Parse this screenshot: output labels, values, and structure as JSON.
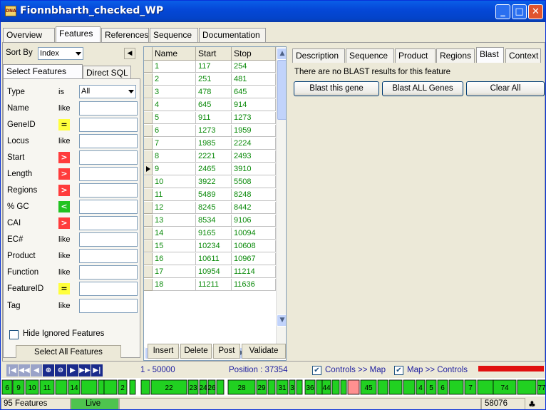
{
  "window": {
    "title": "Fionnbharth_checked_WP",
    "icon_text": "DNA"
  },
  "main_tabs": [
    {
      "label": "Overview",
      "active": false
    },
    {
      "label": "Features",
      "active": true
    },
    {
      "label": "References",
      "active": false
    },
    {
      "label": "Sequence",
      "active": false
    },
    {
      "label": "Documentation",
      "active": false
    }
  ],
  "left": {
    "sort_label": "Sort By",
    "sort_value": "Index",
    "tabs": [
      {
        "label": "Select Features",
        "active": true
      },
      {
        "label": "Direct SQL",
        "active": false
      }
    ],
    "filters": [
      {
        "name": "Type",
        "op": "is",
        "op_style": "text",
        "value": "All"
      },
      {
        "name": "Name",
        "op": "like",
        "op_style": "text",
        "value": ""
      },
      {
        "name": "GeneID",
        "op": "=",
        "op_style": "yellow",
        "value": ""
      },
      {
        "name": "Locus",
        "op": "like",
        "op_style": "text",
        "value": ""
      },
      {
        "name": "Start",
        "op": ">",
        "op_style": "red",
        "value": ""
      },
      {
        "name": "Length",
        "op": ">",
        "op_style": "red",
        "value": ""
      },
      {
        "name": "Regions",
        "op": ">",
        "op_style": "red",
        "value": ""
      },
      {
        "name": "% GC",
        "op": "<",
        "op_style": "green",
        "value": ""
      },
      {
        "name": "CAI",
        "op": ">",
        "op_style": "red",
        "value": ""
      },
      {
        "name": "EC#",
        "op": "like",
        "op_style": "text",
        "value": ""
      },
      {
        "name": "Product",
        "op": "like",
        "op_style": "text",
        "value": ""
      },
      {
        "name": "Function",
        "op": "like",
        "op_style": "text",
        "value": ""
      },
      {
        "name": "FeatureID",
        "op": "=",
        "op_style": "yellow",
        "value": ""
      },
      {
        "name": "Tag",
        "op": "like",
        "op_style": "text",
        "value": ""
      }
    ],
    "hide_ignored_label": "Hide Ignored Features",
    "hide_ignored_checked": false,
    "select_all_label": "Select All Features"
  },
  "grid": {
    "columns": [
      "Name",
      "Start",
      "Stop"
    ],
    "current_row": 8,
    "rows": [
      [
        "1",
        "117",
        "254"
      ],
      [
        "2",
        "251",
        "481"
      ],
      [
        "3",
        "478",
        "645"
      ],
      [
        "4",
        "645",
        "914"
      ],
      [
        "5",
        "911",
        "1273"
      ],
      [
        "6",
        "1273",
        "1959"
      ],
      [
        "7",
        "1985",
        "2224"
      ],
      [
        "8",
        "2221",
        "2493"
      ],
      [
        "9",
        "2465",
        "3910"
      ],
      [
        "10",
        "3922",
        "5508"
      ],
      [
        "11",
        "5489",
        "8248"
      ],
      [
        "12",
        "8245",
        "8442"
      ],
      [
        "13",
        "8534",
        "9106"
      ],
      [
        "14",
        "9165",
        "10094"
      ],
      [
        "15",
        "10234",
        "10608"
      ],
      [
        "16",
        "10611",
        "10967"
      ],
      [
        "17",
        "10954",
        "11214"
      ],
      [
        "18",
        "11211",
        "11636"
      ]
    ],
    "buttons": [
      "Insert",
      "Delete",
      "Post",
      "Validate"
    ]
  },
  "right": {
    "tabs": [
      {
        "label": "Description",
        "active": false
      },
      {
        "label": "Sequence",
        "active": false
      },
      {
        "label": "Product",
        "active": false
      },
      {
        "label": "Regions",
        "active": false
      },
      {
        "label": "Blast",
        "active": true
      },
      {
        "label": "Context",
        "active": false
      }
    ],
    "message": "There are no BLAST results for this feature",
    "buttons": {
      "blast_gene": "Blast this gene",
      "blast_all": "Blast ALL Genes",
      "clear_all": "Clear All"
    }
  },
  "navbar": {
    "range": "1 - 50000",
    "position": "Position : 37354",
    "controls_to_map": "Controls >> Map",
    "map_to_controls": "Map >> Controls",
    "controls_to_map_checked": true,
    "map_to_controls_checked": true
  },
  "map": {
    "labels": [
      "6",
      "9",
      "10",
      "11",
      "14",
      "2",
      "22",
      "23",
      "24",
      "26",
      "28",
      "29",
      "31",
      "3",
      "36",
      "44",
      "45",
      "4",
      "5",
      "6",
      "7",
      "74",
      "77"
    ]
  },
  "status": {
    "features": "95 Features",
    "mode": "Live",
    "count": "58076"
  },
  "colors": {
    "gene_green": "#21d121",
    "gene_pink": "#ff9090",
    "accent_red": "#e01010",
    "text_green": "#0a8a0a"
  }
}
